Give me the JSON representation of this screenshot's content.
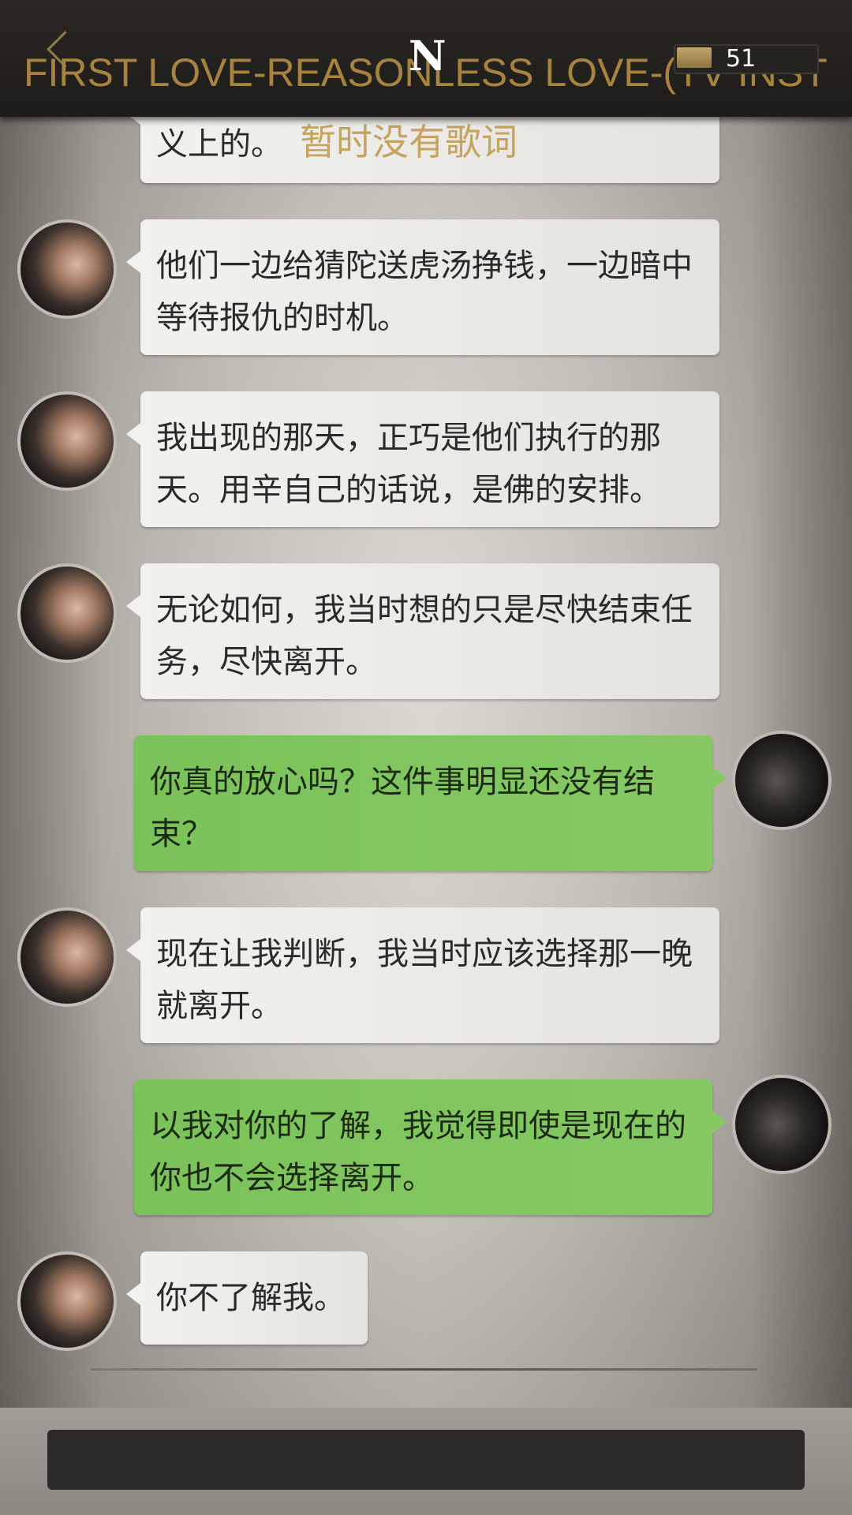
{
  "header": {
    "song_title": "FIRST LOVE-REASONLESS LOVE-(TV INSTR",
    "logo": "N",
    "energy_count": "51",
    "lyrics_note": "暂时没有歌词",
    "energy_level_fraction": 0.25
  },
  "messages": [
    {
      "sender": "other",
      "text": "义上的。"
    },
    {
      "sender": "other",
      "text": "他们一边给猜陀送虎汤挣钱，一边暗中等待报仇的时机。"
    },
    {
      "sender": "other",
      "text": "我出现的那天，正巧是他们执行的那天。用辛自己的话说，是佛的安排。"
    },
    {
      "sender": "other",
      "text": "无论如何，我当时想的只是尽快结束任务，尽快离开。"
    },
    {
      "sender": "me",
      "text": "你真的放心吗？这件事明显还没有结束？"
    },
    {
      "sender": "other",
      "text": "现在让我判断，我当时应该选择那一晚就离开。"
    },
    {
      "sender": "me",
      "text": "以我对你的了解，我觉得即使是现在的你也不会选择离开。"
    },
    {
      "sender": "other",
      "text": "你不了解我。"
    }
  ],
  "icons": {
    "back": "back-chevron-icon",
    "energy": "energy-bar-icon"
  },
  "colors": {
    "my_bubble": "#7fc45c",
    "other_bubble": "#efefec",
    "title_gold": "#a8823f",
    "top_bar": "#232120"
  }
}
